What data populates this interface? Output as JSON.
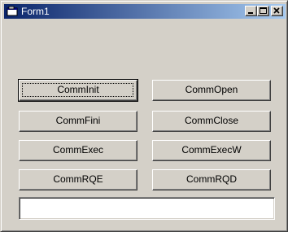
{
  "window": {
    "title": "Form1",
    "titlebar_colors": [
      "#0a246a",
      "#a6caf0"
    ],
    "face_color": "#d4d0c8",
    "icons": {
      "app": "form-icon",
      "minimize": "minimize-icon",
      "maximize": "maximize-icon",
      "close": "close-icon"
    }
  },
  "buttons": {
    "comm_init": "CommInit",
    "comm_open": "CommOpen",
    "comm_fini": "CommFini",
    "comm_close": "CommClose",
    "comm_exec": "CommExec",
    "comm_execw": "CommExecW",
    "comm_rqe": "CommRQE",
    "comm_rqd": "CommRQD"
  },
  "textbox": {
    "value": ""
  }
}
